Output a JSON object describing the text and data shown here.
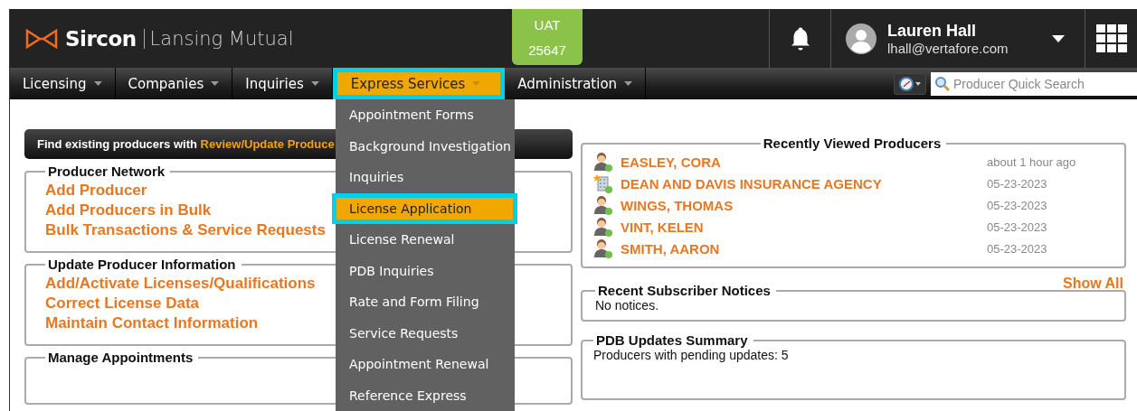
{
  "header": {
    "brand": "Sircon",
    "company": "Lansing Mutual",
    "environment": {
      "label": "UAT",
      "build": "25647"
    },
    "user": {
      "name": "Lauren Hall",
      "email": "lhall@vertafore.com"
    }
  },
  "nav": {
    "items": [
      {
        "label": "Licensing",
        "selected": false
      },
      {
        "label": "Companies",
        "selected": false
      },
      {
        "label": "Inquiries",
        "selected": false
      },
      {
        "label": "Express Services",
        "selected": true
      },
      {
        "label": "Administration",
        "selected": false
      }
    ],
    "search": {
      "placeholder": "Producer Quick Search"
    }
  },
  "dropdown": [
    {
      "label": "Appointment Forms",
      "selected": false
    },
    {
      "label": "Background Investigation",
      "selected": false
    },
    {
      "label": "Inquiries",
      "selected": false
    },
    {
      "label": "License Application",
      "selected": true
    },
    {
      "label": "License Renewal",
      "selected": false
    },
    {
      "label": "PDB Inquiries",
      "selected": false
    },
    {
      "label": "Rate and Form Filing",
      "selected": false
    },
    {
      "label": "Service Requests",
      "selected": false
    },
    {
      "label": "Appointment Renewal",
      "selected": false
    },
    {
      "label": "Reference Express",
      "selected": false
    }
  ],
  "banner": {
    "text": "Find existing producers with ",
    "link": "Review/Update Produce"
  },
  "sections": [
    {
      "title": "Producer Network",
      "links": [
        "Add Producer",
        "Add Producers in Bulk",
        "Bulk Transactions & Service Requests"
      ]
    },
    {
      "title": "Update Producer Information",
      "links": [
        "Add/Activate Licenses/Qualifications",
        "Correct License Data",
        "Maintain Contact Information"
      ]
    },
    {
      "title": "Manage Appointments"
    }
  ],
  "recent_producers": {
    "title": "Recently Viewed Producers",
    "rows": [
      {
        "kind": "person",
        "name": "EASLEY, CORA",
        "time": "about 1 hour ago"
      },
      {
        "kind": "agency",
        "name": "DEAN AND DAVIS INSURANCE AGENCY",
        "time": "05-23-2023"
      },
      {
        "kind": "person",
        "name": "WINGS, THOMAS",
        "time": "05-23-2023"
      },
      {
        "kind": "person",
        "name": "VINT, KELEN",
        "time": "05-23-2023"
      },
      {
        "kind": "person",
        "name": "SMITH, AARON",
        "time": "05-23-2023"
      }
    ]
  },
  "notices": {
    "show_all": "Show All",
    "title": "Recent Subscriber Notices",
    "text": "No notices."
  },
  "pdb": {
    "title": "PDB Updates Summary",
    "text": "Producers with pending updates: 5"
  }
}
